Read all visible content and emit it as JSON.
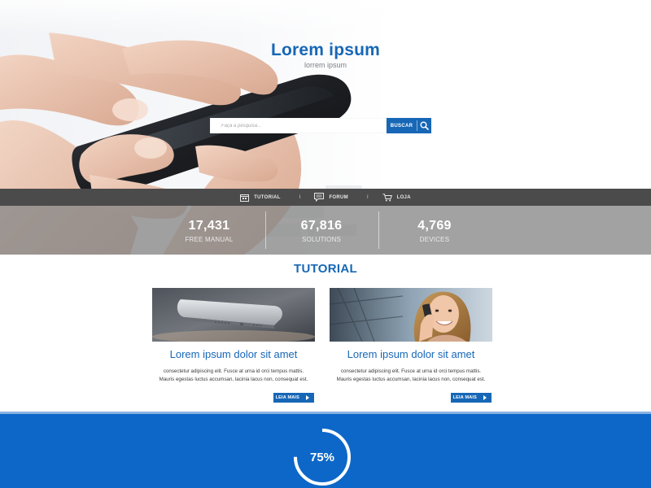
{
  "hero": {
    "title": "Lorem ipsum",
    "subtitle": "lorrem ipsum"
  },
  "search": {
    "placeholder": "Faça a pesquisa...",
    "button_label": "BUSCAR",
    "icon": "search-icon"
  },
  "nav": {
    "items": [
      {
        "label": "TUTORIAL",
        "icon": "calendar-icon"
      },
      {
        "label": "FORUM",
        "icon": "chat-bubble-icon"
      },
      {
        "label": "LOJA",
        "icon": "cart-icon"
      }
    ],
    "separator": "I"
  },
  "stats": [
    {
      "value": "17,431",
      "label": "FREE MANUAL"
    },
    {
      "value": "67,816",
      "label": "SOLUTIONS"
    },
    {
      "value": "4,769",
      "label": "DEVICES"
    }
  ],
  "tutorial": {
    "title": "TUTORIAL",
    "cards": [
      {
        "title": "Lorem ipsum dolor sit amet",
        "text": "consectetur adipiscing elit. Fusce at urna id orci tempus mattis. Mauris egestas luctus accumsan, lacinia lacus non, consequat est.",
        "button_label": "LEIA MAIS",
        "image": "smartphone-photo"
      },
      {
        "title": "Lorem ipsum dolor sit amet",
        "text": "consectetur adipiscing elit. Fusce at urna id orci tempus mattis. Mauris egestas luctus accumsan, lacinia lacus non, consequat est.",
        "button_label": "LEIA MAIS",
        "image": "woman-on-phone-photo"
      }
    ]
  },
  "progress": {
    "label": "75%",
    "value": 0.75
  },
  "colors": {
    "accent": "#1767b6",
    "band": "#0d67c8",
    "nav": "#4b4b4b"
  }
}
